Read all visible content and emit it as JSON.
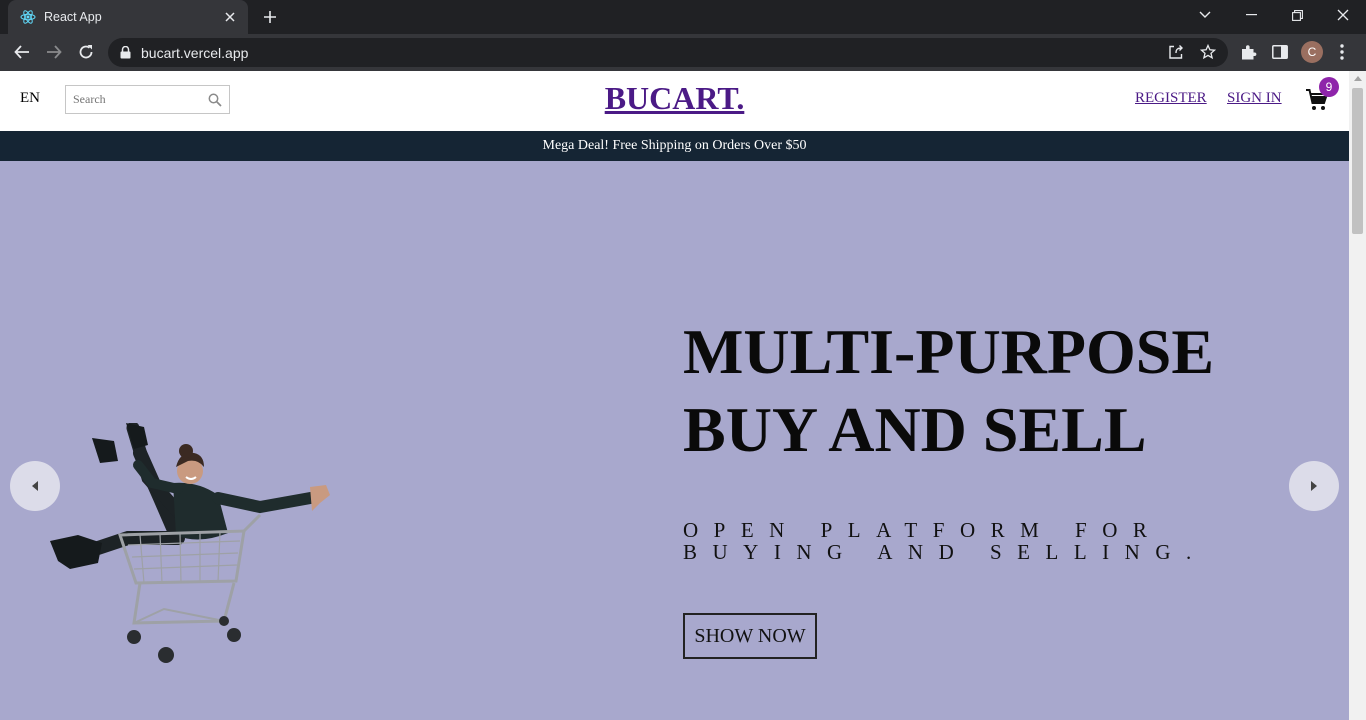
{
  "browser": {
    "tab": {
      "title": "React App"
    },
    "address": {
      "url": "bucart.vercel.app"
    },
    "profile_initial": "C"
  },
  "header": {
    "language": "EN",
    "search_placeholder": "Search",
    "logo": "BUCART.",
    "register_label": "REGISTER",
    "signin_label": "SIGN IN",
    "cart_count": "9"
  },
  "announcement": "Mega Deal! Free Shipping on Orders Over $50",
  "hero": {
    "title_line1": "MULTI-PURPOSE",
    "title_line2": "BUY AND SELL",
    "subtitle": "OPEN PLATFORM FOR BUYING AND SELLING.",
    "cta_label": "SHOW NOW"
  },
  "colors": {
    "brand": "#4b1a86",
    "announcement_bg": "#152534",
    "hero_bg": "#a8a8cd",
    "badge": "#8e24aa"
  },
  "icons": [
    "react-favicon",
    "close-icon",
    "plus-icon",
    "chevron-down-icon",
    "minimize-icon",
    "restore-icon",
    "back-icon",
    "forward-icon",
    "reload-icon",
    "lock-icon",
    "share-icon",
    "star-icon",
    "extensions-icon",
    "side-panel-icon",
    "kebab-menu-icon",
    "search-icon",
    "cart-icon",
    "arrow-left-icon",
    "arrow-right-icon"
  ]
}
